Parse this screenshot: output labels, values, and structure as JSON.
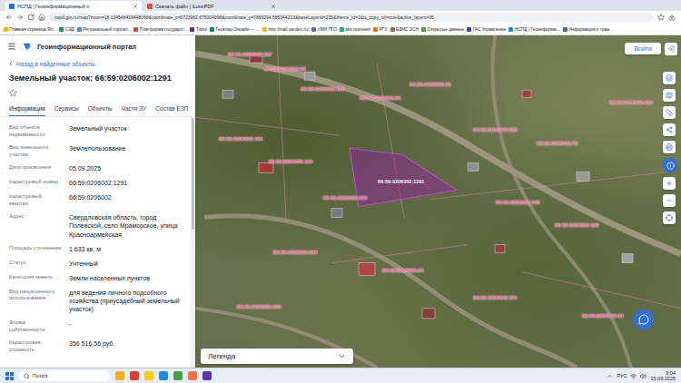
{
  "browser": {
    "tabs": [
      {
        "label": "НСПД | Геоинформационный п",
        "selected": true
      },
      {
        "label": "Скачать файл | iLovePDF",
        "selected": false
      }
    ],
    "address": "nspd.gov.ru/map?zoom=18.134548419448068&coordinate_x=6723962.675004098&coordinate_y=7669294.585344213&baseLayerId=235&theme_id=1&is_copy_url=true&active_layers=36",
    "bookmarks": [
      "Главная страница Ял...",
      "СЭД",
      "Региональный портал...",
      "Платформа государст...",
      "Торги",
      "Геоклад-Онлайн — ...",
      "http://mail.yandex.ru/",
      "УМИ ПГО",
      "pkk.rosreestr",
      "РГУ",
      "ЕФИС ЗСН",
      "Открытые данные",
      "ГАС Управление",
      "НСПД | Геоинформа...",
      "Информация о тран..."
    ]
  },
  "app": {
    "title": "Геоинформационный портал",
    "back": "Назад в найденные объекты",
    "object_title": "Земельный участок: 66:59:0206002:1291",
    "favorite": false,
    "tabs": [
      {
        "label": "Информация",
        "selected": true
      },
      {
        "label": "Сервисы",
        "selected": false
      },
      {
        "label": "Объекты",
        "selected": false
      },
      {
        "label": "Части ЗУ",
        "selected": false
      },
      {
        "label": "Состав ЕЗП",
        "selected": false
      }
    ],
    "fields": [
      {
        "label": "Вид объекта недвижимости",
        "value": "Земельный участок"
      },
      {
        "label": "Вид земельного участка",
        "value": "Землепользование"
      },
      {
        "label": "Дата присвоения",
        "value": "05.09.2025"
      },
      {
        "label": "Кадастровый номер",
        "value": "66:59:0206002:1291"
      },
      {
        "label": "Кадастровый квартал",
        "value": "66:59:0206002"
      },
      {
        "label": "Адрес",
        "value": "Свердловская область, город Полевской, село Мраморское, улица Красноармейская"
      },
      {
        "label": "Площадь уточненная",
        "value": "1 633 кв. м"
      },
      {
        "label": "Статус",
        "value": "Учтенный"
      },
      {
        "label": "Категория земель",
        "value": "Земли населенных пунктов"
      },
      {
        "label": "Вид разрешенного использования",
        "value": "для ведения личного подсобного хозяйства (приусадебный земельный участок)"
      },
      {
        "label": "Форма собственности",
        "value": "-"
      },
      {
        "label": "Кадастровая стоимость",
        "value": "356 516,56 руб."
      }
    ],
    "scrollbar": {
      "level": 0.45
    }
  },
  "map": {
    "login": "Войти",
    "legend": "Легенда",
    "labels": [
      {
        "text": "66:59:0206002:127",
        "highlighted": false
      },
      {
        "text": "66:59:0206002:99",
        "highlighted": false
      },
      {
        "text": "66:59:0206002:110",
        "highlighted": false
      },
      {
        "text": "66:59:0206002:33",
        "highlighted": false
      },
      {
        "text": "66:59:0206002:64",
        "highlighted": false
      },
      {
        "text": "66:59:0206002:151",
        "highlighted": false
      },
      {
        "text": "66:59:0206002:134",
        "highlighted": false
      },
      {
        "text": "66:59:0206002:1291",
        "highlighted": true
      },
      {
        "text": "66:59:0206002:232",
        "highlighted": false
      },
      {
        "text": "66:59:0206002:108",
        "highlighted": false
      },
      {
        "text": "66:59:0206002:72",
        "highlighted": false
      },
      {
        "text": "66:59:0206002:257",
        "highlighted": false
      },
      {
        "text": "66:59:0206002:156",
        "highlighted": false
      },
      {
        "text": "66:59:0206002:189",
        "highlighted": false
      },
      {
        "text": "66:59:0206002:244",
        "highlighted": false
      },
      {
        "text": "66:59:0206002:84",
        "highlighted": false
      },
      {
        "text": "66:59:0206002:171",
        "highlighted": false
      },
      {
        "text": "66:59:0206002:93",
        "highlighted": false
      },
      {
        "text": "66:59:0206002:210",
        "highlighted": false
      }
    ]
  },
  "taskbar": {
    "search": "Поиск",
    "lang": "РУС",
    "time": "9:04",
    "date": "15.09.2025"
  }
}
